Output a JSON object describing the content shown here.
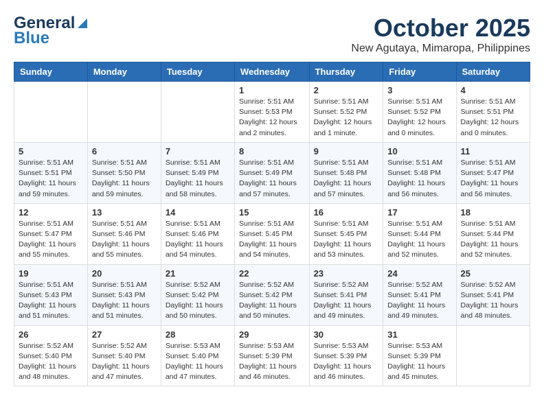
{
  "header": {
    "logo_line1": "General",
    "logo_line2": "Blue",
    "month": "October 2025",
    "location": "New Agutaya, Mimaropa, Philippines"
  },
  "weekdays": [
    "Sunday",
    "Monday",
    "Tuesday",
    "Wednesday",
    "Thursday",
    "Friday",
    "Saturday"
  ],
  "weeks": [
    [
      {
        "day": "",
        "info": ""
      },
      {
        "day": "",
        "info": ""
      },
      {
        "day": "",
        "info": ""
      },
      {
        "day": "1",
        "info": "Sunrise: 5:51 AM\nSunset: 5:53 PM\nDaylight: 12 hours\nand 2 minutes."
      },
      {
        "day": "2",
        "info": "Sunrise: 5:51 AM\nSunset: 5:52 PM\nDaylight: 12 hours\nand 1 minute."
      },
      {
        "day": "3",
        "info": "Sunrise: 5:51 AM\nSunset: 5:52 PM\nDaylight: 12 hours\nand 0 minutes."
      },
      {
        "day": "4",
        "info": "Sunrise: 5:51 AM\nSunset: 5:51 PM\nDaylight: 12 hours\nand 0 minutes."
      }
    ],
    [
      {
        "day": "5",
        "info": "Sunrise: 5:51 AM\nSunset: 5:51 PM\nDaylight: 11 hours\nand 59 minutes."
      },
      {
        "day": "6",
        "info": "Sunrise: 5:51 AM\nSunset: 5:50 PM\nDaylight: 11 hours\nand 59 minutes."
      },
      {
        "day": "7",
        "info": "Sunrise: 5:51 AM\nSunset: 5:49 PM\nDaylight: 11 hours\nand 58 minutes."
      },
      {
        "day": "8",
        "info": "Sunrise: 5:51 AM\nSunset: 5:49 PM\nDaylight: 11 hours\nand 57 minutes."
      },
      {
        "day": "9",
        "info": "Sunrise: 5:51 AM\nSunset: 5:48 PM\nDaylight: 11 hours\nand 57 minutes."
      },
      {
        "day": "10",
        "info": "Sunrise: 5:51 AM\nSunset: 5:48 PM\nDaylight: 11 hours\nand 56 minutes."
      },
      {
        "day": "11",
        "info": "Sunrise: 5:51 AM\nSunset: 5:47 PM\nDaylight: 11 hours\nand 56 minutes."
      }
    ],
    [
      {
        "day": "12",
        "info": "Sunrise: 5:51 AM\nSunset: 5:47 PM\nDaylight: 11 hours\nand 55 minutes."
      },
      {
        "day": "13",
        "info": "Sunrise: 5:51 AM\nSunset: 5:46 PM\nDaylight: 11 hours\nand 55 minutes."
      },
      {
        "day": "14",
        "info": "Sunrise: 5:51 AM\nSunset: 5:46 PM\nDaylight: 11 hours\nand 54 minutes."
      },
      {
        "day": "15",
        "info": "Sunrise: 5:51 AM\nSunset: 5:45 PM\nDaylight: 11 hours\nand 54 minutes."
      },
      {
        "day": "16",
        "info": "Sunrise: 5:51 AM\nSunset: 5:45 PM\nDaylight: 11 hours\nand 53 minutes."
      },
      {
        "day": "17",
        "info": "Sunrise: 5:51 AM\nSunset: 5:44 PM\nDaylight: 11 hours\nand 52 minutes."
      },
      {
        "day": "18",
        "info": "Sunrise: 5:51 AM\nSunset: 5:44 PM\nDaylight: 11 hours\nand 52 minutes."
      }
    ],
    [
      {
        "day": "19",
        "info": "Sunrise: 5:51 AM\nSunset: 5:43 PM\nDaylight: 11 hours\nand 51 minutes."
      },
      {
        "day": "20",
        "info": "Sunrise: 5:51 AM\nSunset: 5:43 PM\nDaylight: 11 hours\nand 51 minutes."
      },
      {
        "day": "21",
        "info": "Sunrise: 5:52 AM\nSunset: 5:42 PM\nDaylight: 11 hours\nand 50 minutes."
      },
      {
        "day": "22",
        "info": "Sunrise: 5:52 AM\nSunset: 5:42 PM\nDaylight: 11 hours\nand 50 minutes."
      },
      {
        "day": "23",
        "info": "Sunrise: 5:52 AM\nSunset: 5:41 PM\nDaylight: 11 hours\nand 49 minutes."
      },
      {
        "day": "24",
        "info": "Sunrise: 5:52 AM\nSunset: 5:41 PM\nDaylight: 11 hours\nand 49 minutes."
      },
      {
        "day": "25",
        "info": "Sunrise: 5:52 AM\nSunset: 5:41 PM\nDaylight: 11 hours\nand 48 minutes."
      }
    ],
    [
      {
        "day": "26",
        "info": "Sunrise: 5:52 AM\nSunset: 5:40 PM\nDaylight: 11 hours\nand 48 minutes."
      },
      {
        "day": "27",
        "info": "Sunrise: 5:52 AM\nSunset: 5:40 PM\nDaylight: 11 hours\nand 47 minutes."
      },
      {
        "day": "28",
        "info": "Sunrise: 5:53 AM\nSunset: 5:40 PM\nDaylight: 11 hours\nand 47 minutes."
      },
      {
        "day": "29",
        "info": "Sunrise: 5:53 AM\nSunset: 5:39 PM\nDaylight: 11 hours\nand 46 minutes."
      },
      {
        "day": "30",
        "info": "Sunrise: 5:53 AM\nSunset: 5:39 PM\nDaylight: 11 hours\nand 46 minutes."
      },
      {
        "day": "31",
        "info": "Sunrise: 5:53 AM\nSunset: 5:39 PM\nDaylight: 11 hours\nand 45 minutes."
      },
      {
        "day": "",
        "info": ""
      }
    ]
  ]
}
